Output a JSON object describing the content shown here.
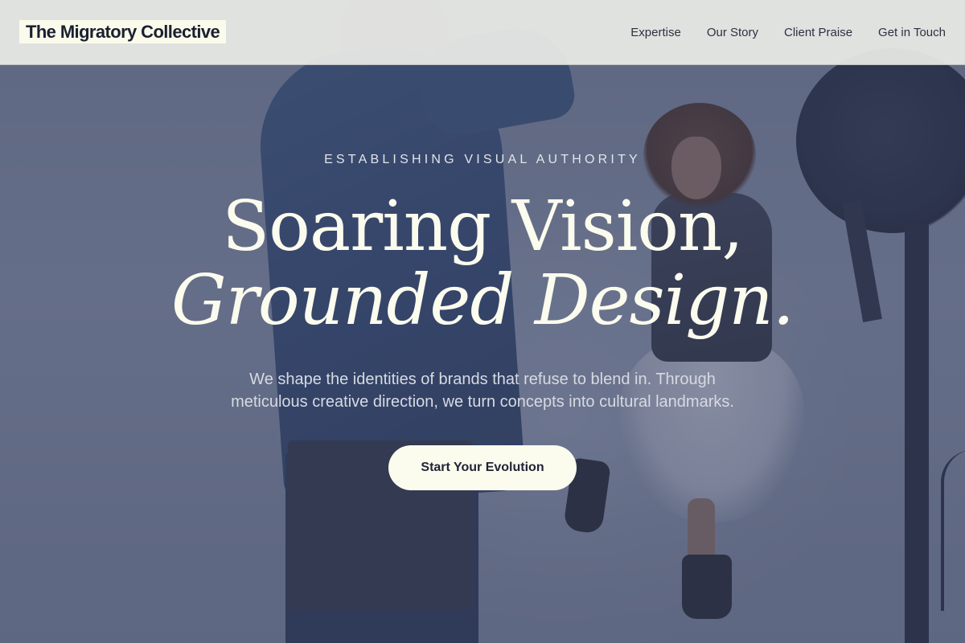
{
  "nav": {
    "logo": "The Migratory Collective",
    "links": [
      "Expertise",
      "Our Story",
      "Client Praise",
      "Get in Touch"
    ]
  },
  "hero": {
    "eyebrow": "ESTABLISHING VISUAL AUTHORITY",
    "headline_line1": "Soaring Vision,",
    "headline_line2": "Grounded Design.",
    "subtext": "We shape the identities of brands that refuse to blend in. Through meticulous creative direction, we turn concepts into cultural landmarks.",
    "cta_label": "Start Your Evolution"
  },
  "colors": {
    "navbar_bg": "#ecede8",
    "logo_bg": "#fbfbec",
    "headline": "#fbfbee",
    "cta_bg": "#fbfbee",
    "cta_text": "#1f2433",
    "overlay": "#3a4462"
  }
}
